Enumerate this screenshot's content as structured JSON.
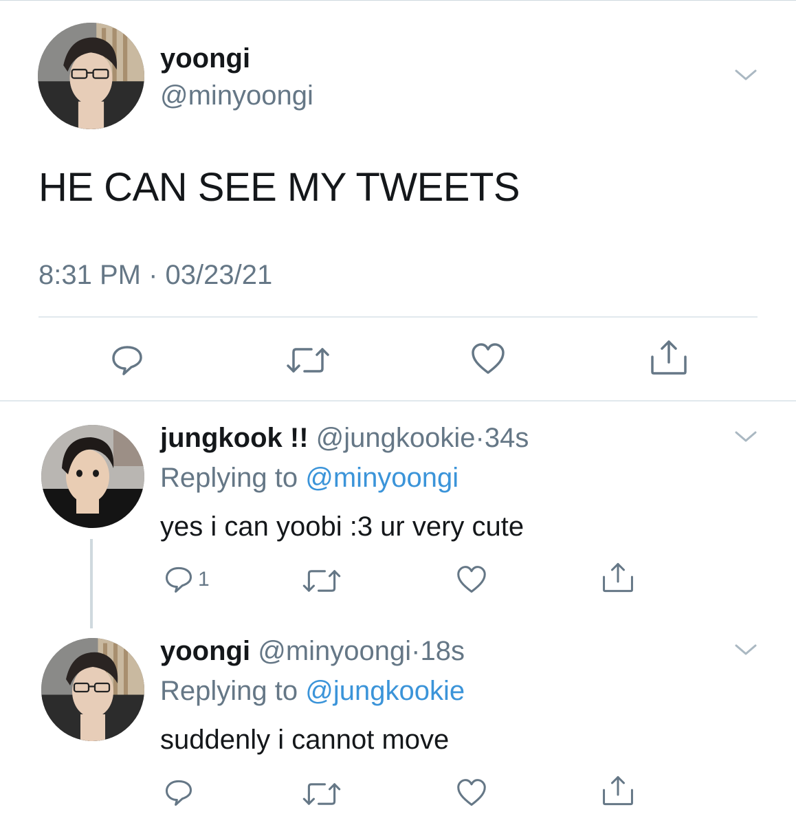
{
  "main_tweet": {
    "display_name": "yoongi",
    "handle": "@minyoongi",
    "text": "HE CAN SEE MY TWEETS",
    "time": "8:31 PM",
    "separator": "·",
    "date": "03/23/21",
    "icons": {
      "avatar": "profile-photo",
      "menu": "chevron-down-icon",
      "reply": "comment-bubble-icon",
      "retweet": "retweet-icon",
      "like": "heart-icon",
      "share": "share-icon"
    }
  },
  "replies": [
    {
      "display_name": "jungkook !!",
      "handle": "@jungkookie",
      "separator": "·",
      "time": "34s",
      "replying_prefix": "Replying to",
      "replying_to": "@minyoongi",
      "text": "yes i can yoobi :3 ur very cute",
      "reply_count": "1"
    },
    {
      "display_name": "yoongi",
      "handle": "@minyoongi",
      "separator": "·",
      "time": "18s",
      "replying_prefix": "Replying to",
      "replying_to": "@jungkookie",
      "text": "suddenly i cannot move",
      "reply_count": ""
    }
  ],
  "colors": {
    "text_primary": "#14171a",
    "text_secondary": "#657786",
    "mention": "#3b94d9",
    "divider": "#e1e8ed",
    "thread_line": "#cfd9de"
  }
}
